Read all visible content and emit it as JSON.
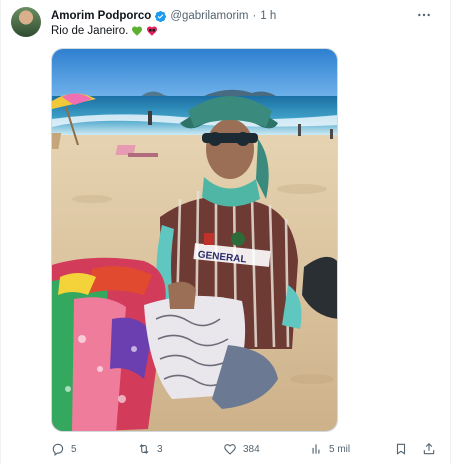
{
  "tweet": {
    "author": {
      "display_name": "Amorim Podporco",
      "handle": "@gabrilamorim",
      "verified": true
    },
    "separator": "·",
    "timestamp": "1 h",
    "text": "Rio de Janeiro.",
    "emojis": [
      "green-heart-emoji",
      "black-red-heart-emoji"
    ],
    "media": {
      "type": "photo",
      "description_icon": "beach-vendor-photo"
    },
    "metrics": {
      "replies": "5",
      "reposts": "3",
      "likes": "384",
      "views": "5 mil"
    }
  },
  "colors": {
    "text_primary": "#0f1419",
    "text_secondary": "#536471",
    "verified_badge": "#1d9bf0",
    "border": "#cfd9de"
  }
}
